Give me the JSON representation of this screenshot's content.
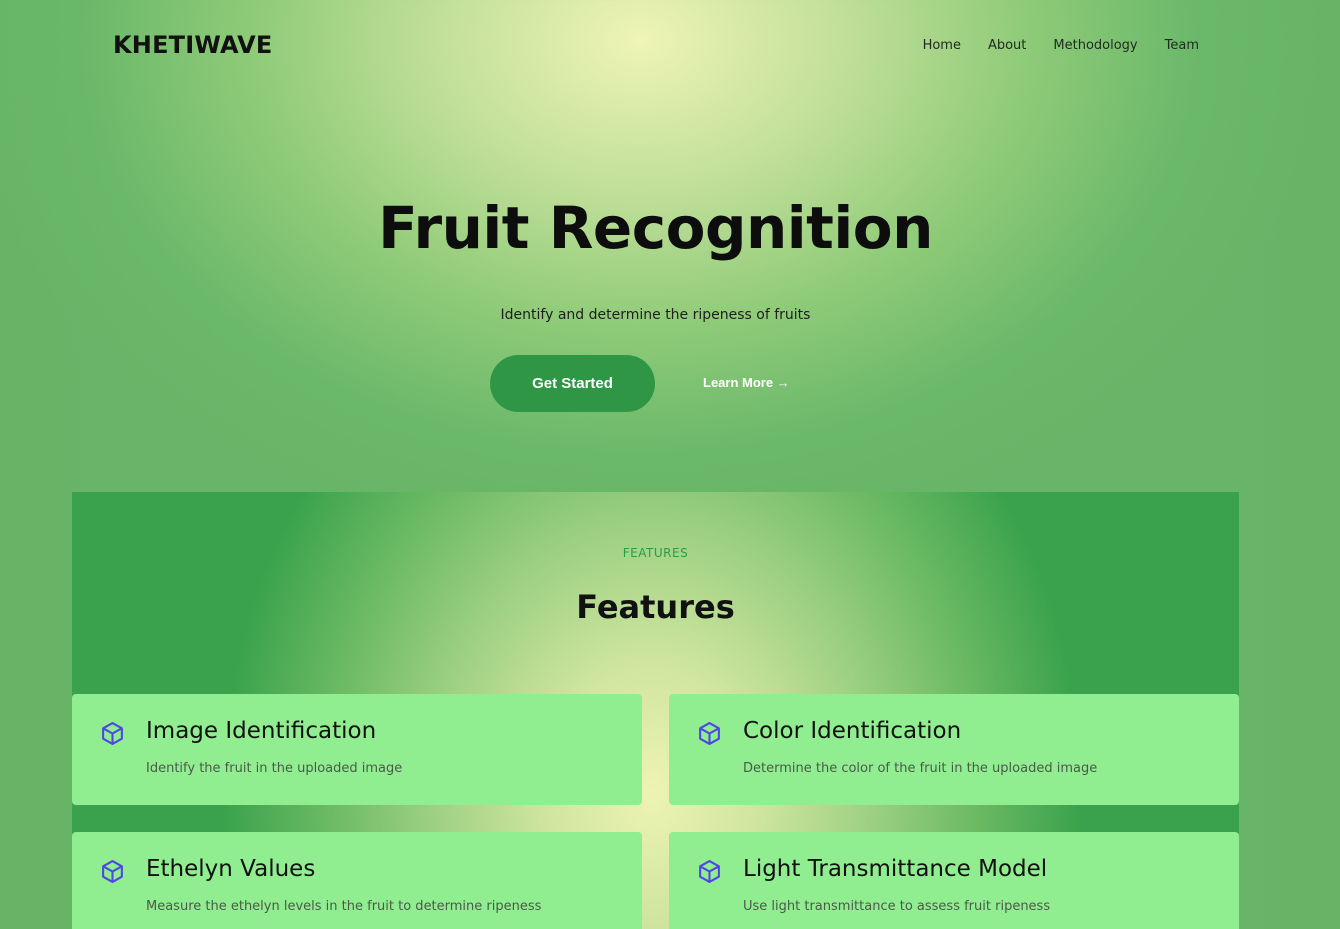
{
  "header": {
    "logo": "KHETIWAVE",
    "nav": [
      "Home",
      "About",
      "Methodology",
      "Team"
    ]
  },
  "hero": {
    "title": "Fruit Recognition",
    "subtitle": "Identify and determine the ripeness of fruits",
    "primary_button": "Get Started",
    "secondary_link": "Learn More →"
  },
  "features": {
    "eyebrow": "FEATURES",
    "heading": "Features",
    "cards": [
      {
        "title": "Image Identification",
        "description": "Identify the fruit in the uploaded image",
        "icon": "cube-icon"
      },
      {
        "title": "Color Identification",
        "description": "Determine the color of the fruit in the uploaded image",
        "icon": "cube-icon"
      },
      {
        "title": "Ethelyn Values",
        "description": "Measure the ethelyn levels in the fruit to determine ripeness",
        "icon": "cube-icon"
      },
      {
        "title": "Light Transmittance Model",
        "description": "Use light transmittance to assess fruit ripeness",
        "icon": "cube-icon"
      }
    ]
  },
  "colors": {
    "accent_green": "#2e9645",
    "card_bg": "#90ee90",
    "icon_color": "#4f46e5"
  }
}
